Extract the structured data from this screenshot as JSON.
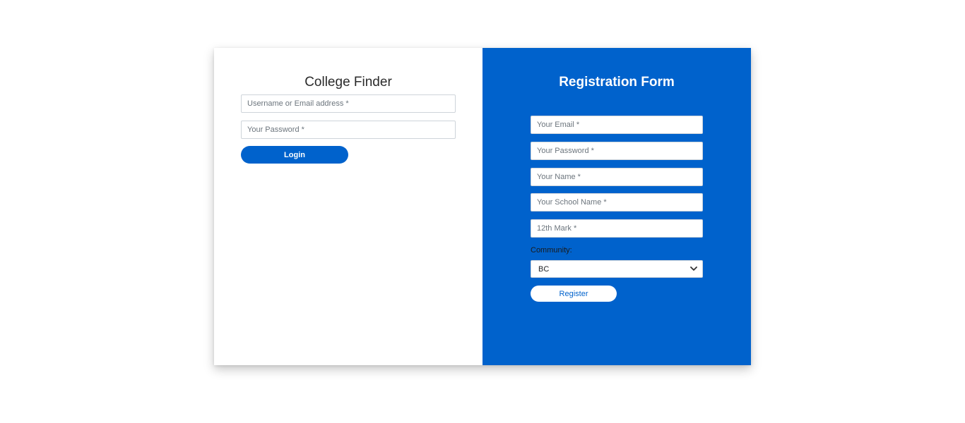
{
  "login": {
    "title": "College Finder",
    "username_placeholder": "Username or Email address *",
    "password_placeholder": "Your Password *",
    "login_label": "Login"
  },
  "registration": {
    "title": "Registration Form",
    "email_placeholder": "Your Email *",
    "password_placeholder": "Your Password *",
    "name_placeholder": "Your Name *",
    "school_placeholder": "Your School Name *",
    "mark_placeholder": "12th Mark *",
    "community_label": "Community:",
    "community_selected": "BC",
    "register_label": "Register"
  },
  "icons": {
    "select_chevron": "chevron-down-icon"
  },
  "colors": {
    "primary": "#0062cc",
    "panel_bg": "#ffffff"
  }
}
